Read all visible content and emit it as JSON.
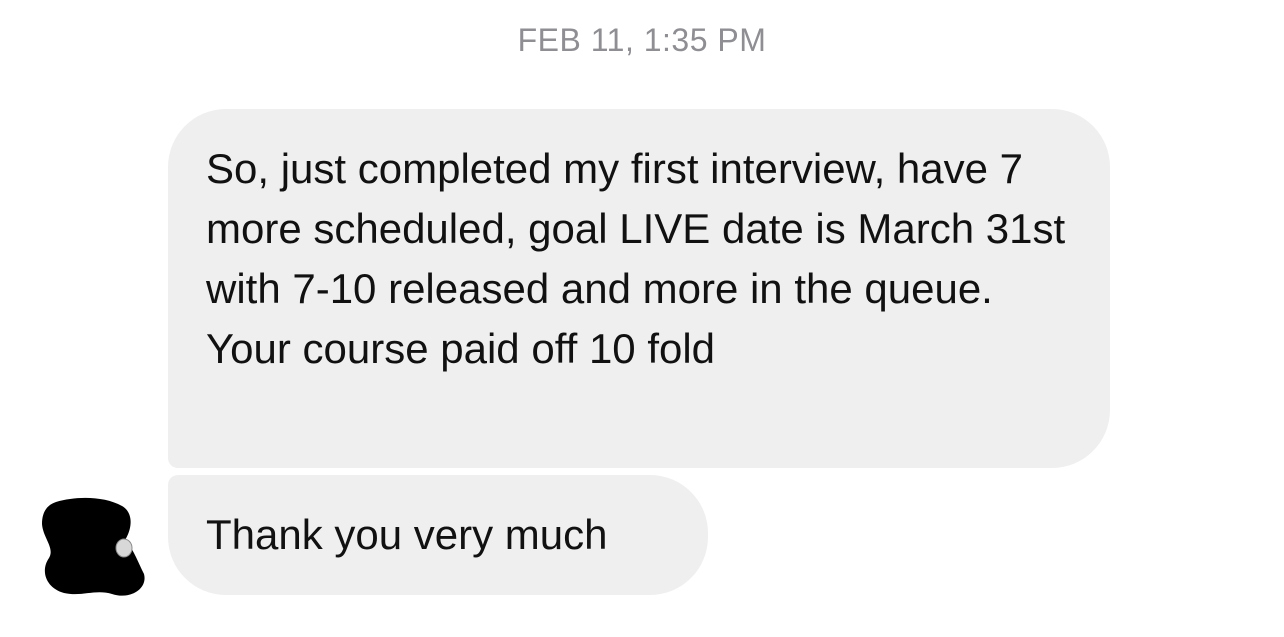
{
  "conversation": {
    "timestamp": "FEB 11, 1:35 PM",
    "messages": [
      {
        "text": "So, just completed my first interview, have 7 more scheduled, goal LIVE date is March 31st with 7-10 released and more in the queue. Your course paid off 10 fold"
      },
      {
        "text": "Thank you very much"
      }
    ]
  },
  "colors": {
    "bubble_background": "#efefef",
    "timestamp_text": "#8e8e93",
    "message_text": "#111111"
  },
  "icons": {
    "avatar": "redacted-avatar-icon"
  }
}
